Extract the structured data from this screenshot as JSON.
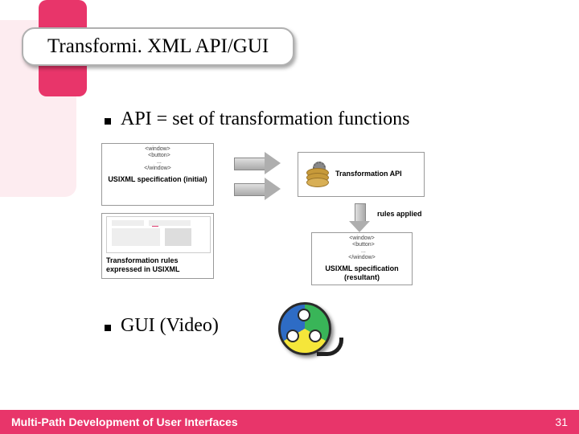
{
  "slide": {
    "title": "Transformi. XML API/GUI",
    "bullets": {
      "b1": "API = set of transformation functions",
      "b2": "GUI (Video)"
    }
  },
  "diagram": {
    "initial": {
      "code": "<window>\n  <button>\n  ...\n</window>",
      "label": "USIXML specification (initial)"
    },
    "rules": {
      "label": "Transformation rules expressed in USIXML"
    },
    "api": {
      "label": "Transformation API"
    },
    "applied": "rules applied",
    "result": {
      "code": "<window>\n  <button>\n  ...\n</window>",
      "label": "USIXML specification (resultant)"
    }
  },
  "footer": {
    "title": "Multi-Path Development of User Interfaces",
    "page": "31"
  },
  "colors": {
    "accent": "#e8356a",
    "accent_light": "#fdecf0"
  }
}
